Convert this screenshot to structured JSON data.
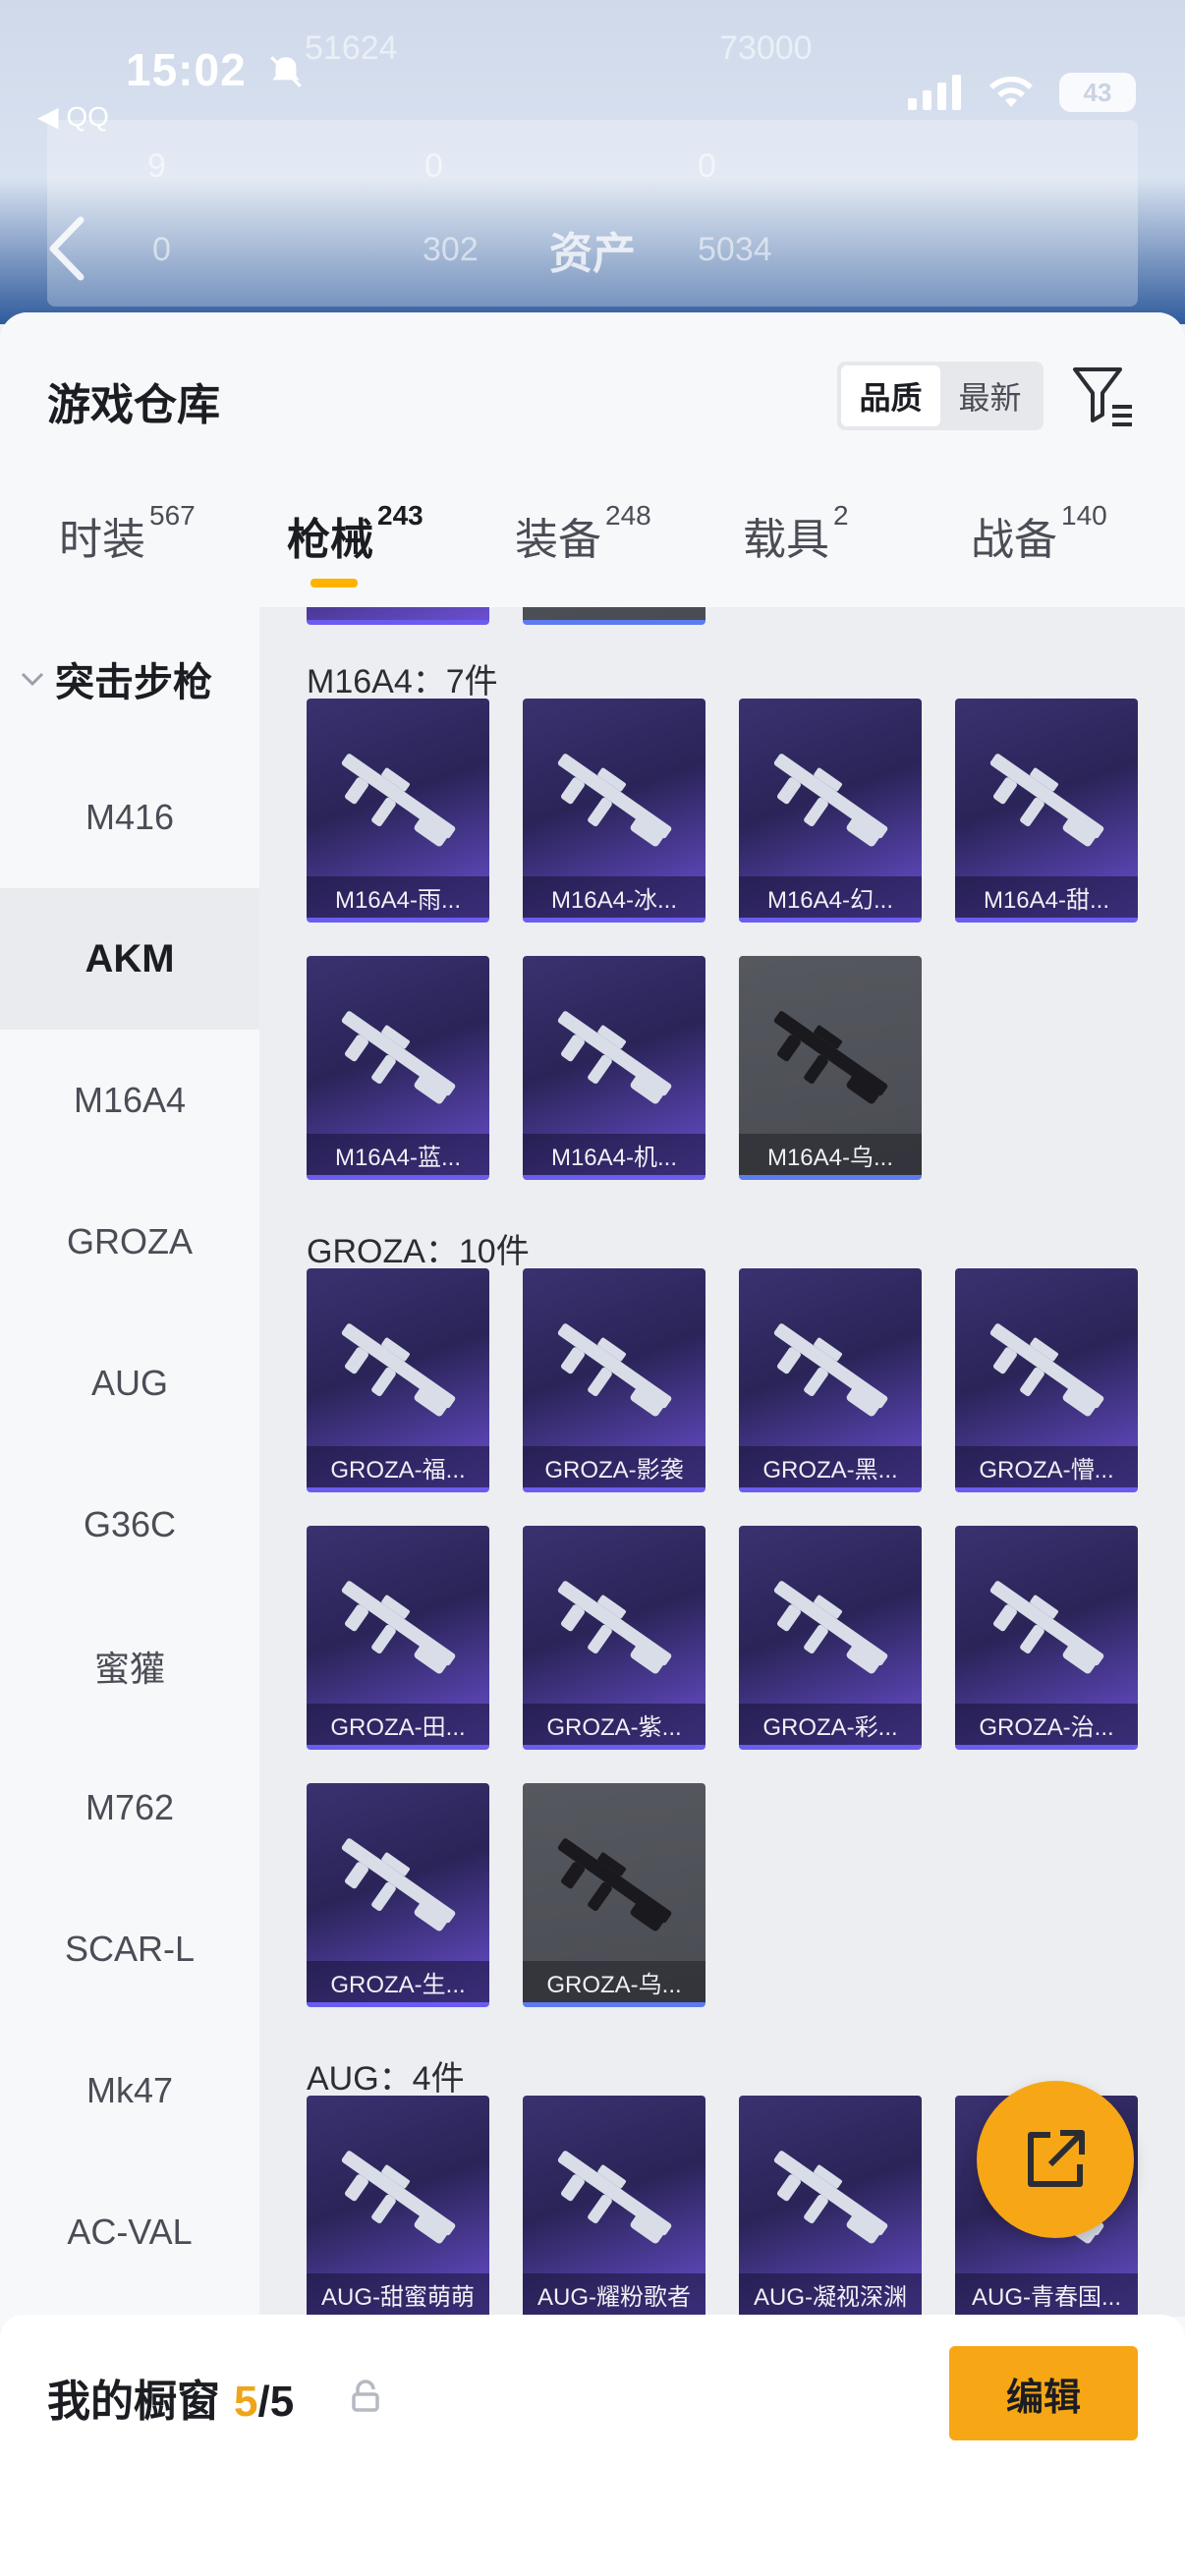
{
  "status_bar": {
    "time": "15:02",
    "back_app": "◀ QQ",
    "battery": "43"
  },
  "background_header": {
    "title": "资产",
    "ghost_values": [
      "51624",
      "73000",
      "9",
      "0",
      "0",
      "0",
      "302",
      "5034"
    ]
  },
  "sheet": {
    "title": "游戏仓库",
    "sort_options": [
      {
        "label": "品质",
        "active": true
      },
      {
        "label": "最新",
        "active": false
      }
    ],
    "tabs": [
      {
        "label": "时装",
        "count": "567"
      },
      {
        "label": "枪械",
        "count": "243"
      },
      {
        "label": "装备",
        "count": "248"
      },
      {
        "label": "载具",
        "count": "2"
      },
      {
        "label": "战备",
        "count": "140"
      }
    ],
    "active_tab": "枪械"
  },
  "sidebar": {
    "group": "突击步枪",
    "items": [
      "M416",
      "AKM",
      "M16A4",
      "GROZA",
      "AUG",
      "G36C",
      "蜜獾",
      "M762",
      "SCAR-L",
      "Mk47",
      "AC-VAL"
    ],
    "active_item": "AKM"
  },
  "sections": [
    {
      "title": "M16A4：7件",
      "items": [
        {
          "name": "M16A4-雨...",
          "grade": "purple"
        },
        {
          "name": "M16A4-冰...",
          "grade": "purple"
        },
        {
          "name": "M16A4-幻...",
          "grade": "purple"
        },
        {
          "name": "M16A4-甜...",
          "grade": "purple"
        },
        {
          "name": "M16A4-蓝...",
          "grade": "purple"
        },
        {
          "name": "M16A4-机...",
          "grade": "purple"
        },
        {
          "name": "M16A4-乌...",
          "grade": "grey"
        }
      ]
    },
    {
      "title": "GROZA：10件",
      "items": [
        {
          "name": "GROZA-福...",
          "grade": "purple"
        },
        {
          "name": "GROZA-影袭",
          "grade": "purple"
        },
        {
          "name": "GROZA-黑...",
          "grade": "purple"
        },
        {
          "name": "GROZA-懵...",
          "grade": "purple"
        },
        {
          "name": "GROZA-田...",
          "grade": "purple"
        },
        {
          "name": "GROZA-紫...",
          "grade": "purple"
        },
        {
          "name": "GROZA-彩...",
          "grade": "purple"
        },
        {
          "name": "GROZA-治...",
          "grade": "purple"
        },
        {
          "name": "GROZA-生...",
          "grade": "purple"
        },
        {
          "name": "GROZA-乌...",
          "grade": "grey"
        }
      ]
    },
    {
      "title": "AUG：4件",
      "items": [
        {
          "name": "AUG-甜蜜萌萌",
          "grade": "purple"
        },
        {
          "name": "AUG-耀粉歌者",
          "grade": "purple"
        },
        {
          "name": "AUG-凝视深渊",
          "grade": "purple"
        },
        {
          "name": "AUG-青春国...",
          "grade": "purple"
        }
      ]
    }
  ],
  "bottom_bar": {
    "label": "我的橱窗",
    "count": "5",
    "total": "/5",
    "edit_label": "编辑"
  },
  "colors": {
    "accent": "#f7a716",
    "count_highlight": "#f0a41a",
    "card_purple": "#2a2458",
    "card_grey": "#4a4c53"
  }
}
